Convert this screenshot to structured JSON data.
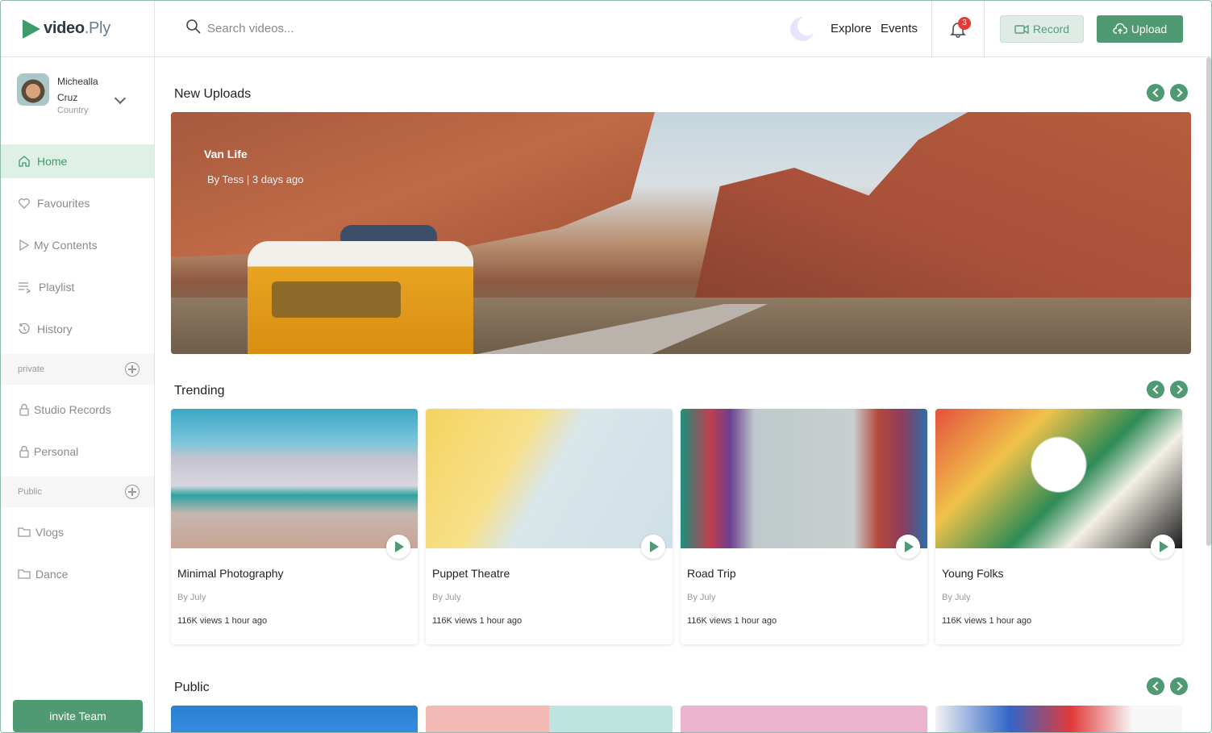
{
  "app": {
    "logo_main": "video",
    "logo_suffix": ".Ply"
  },
  "profile": {
    "name_first": "Michealla",
    "name_last": "Cruz",
    "country": "Country"
  },
  "sidebar": {
    "items": [
      {
        "label": "Home",
        "icon": "home-icon",
        "active": true
      },
      {
        "label": "Favourites",
        "icon": "heart-icon"
      },
      {
        "label": "My Contents",
        "icon": "play-outline-icon"
      },
      {
        "label": "Playlist",
        "icon": "playlist-icon"
      },
      {
        "label": "History",
        "icon": "history-icon"
      }
    ],
    "private_label": "private",
    "private_items": [
      {
        "label": "Studio Records",
        "icon": "lock-icon"
      },
      {
        "label": "Personal",
        "icon": "lock-icon"
      }
    ],
    "public_label": "Public",
    "public_items": [
      {
        "label": "Vlogs",
        "icon": "folder-icon"
      },
      {
        "label": "Dance",
        "icon": "folder-icon"
      }
    ],
    "invite_label": "invite Team"
  },
  "header": {
    "search_placeholder": "Search videos...",
    "nav": [
      "Explore",
      "Events"
    ],
    "notification_count": "3",
    "record_label": "Record",
    "upload_label": "Upload"
  },
  "sections": {
    "new_uploads": "New Uploads",
    "trending": "Trending",
    "public": "Public"
  },
  "hero": {
    "title": "Van Life",
    "meta": "By Tess | 3 days ago"
  },
  "trending": [
    {
      "title": "Minimal Photography",
      "by": "By July",
      "meta": "116K views 1 hour ago"
    },
    {
      "title": "Puppet Theatre",
      "by": "By July",
      "meta": "116K views 1 hour ago"
    },
    {
      "title": "Road Trip",
      "by": "By July",
      "meta": "116K views 1 hour ago"
    },
    {
      "title": "Young Folks",
      "by": "By July",
      "meta": "116K views 1 hour ago"
    }
  ],
  "colors": {
    "accent": "#4f9a72",
    "active_bg": "#dff0e7",
    "badge": "#e53935"
  }
}
